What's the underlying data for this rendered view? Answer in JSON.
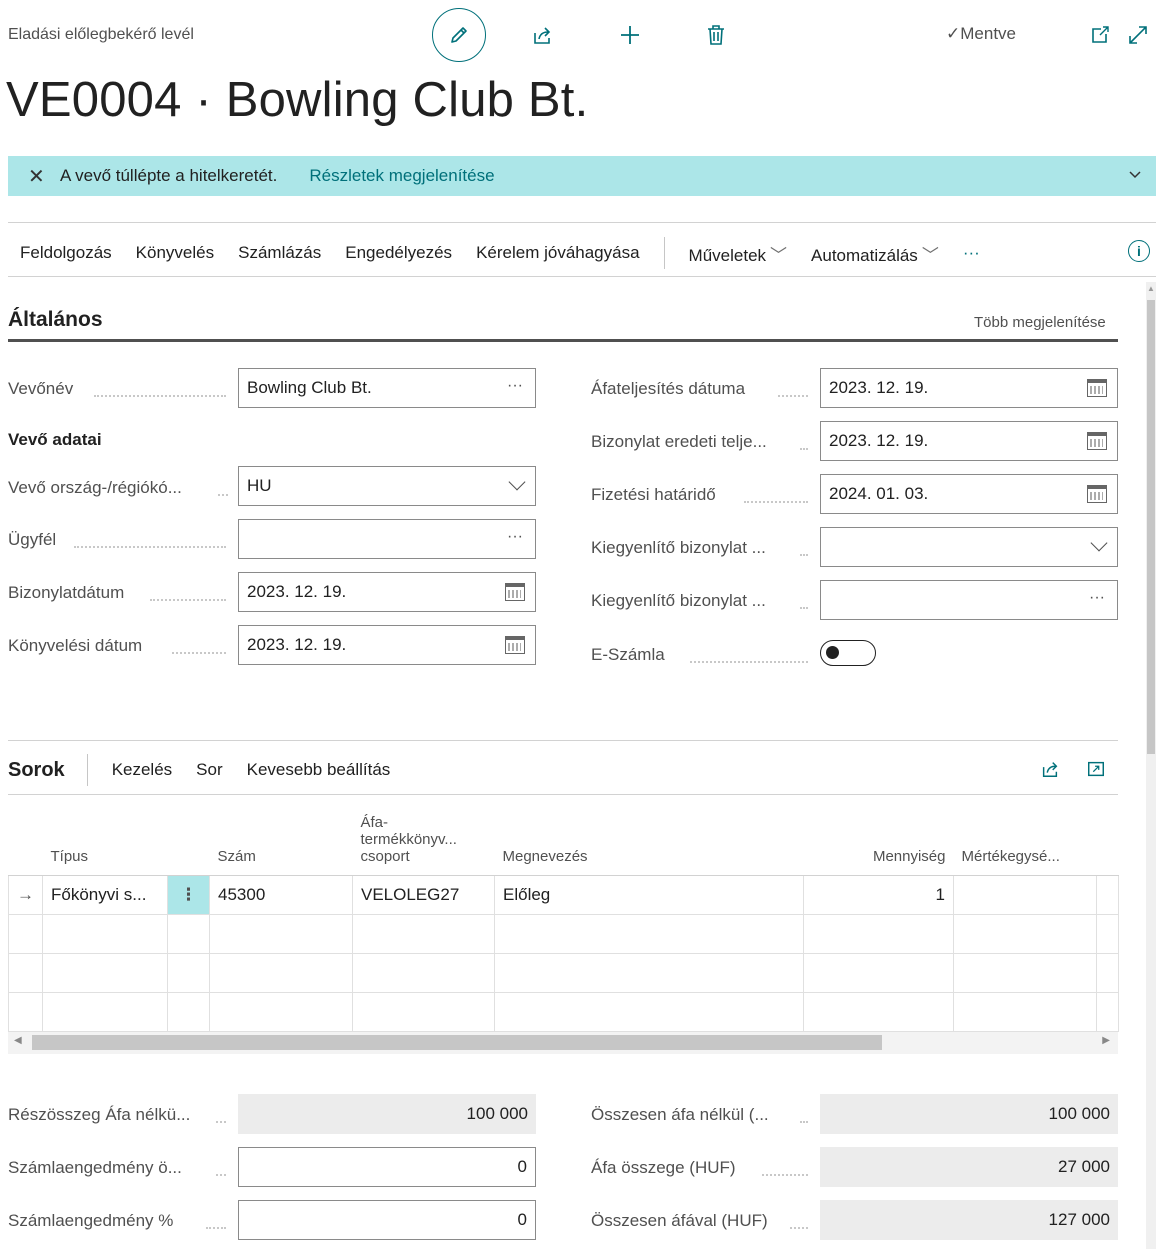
{
  "header": {
    "page_caption": "Eladási előlegbekérő levél",
    "saved_label": "Mentve",
    "title": "VE0004 · Bowling Club Bt."
  },
  "notification": {
    "message": "A vevő túllépte a hitelkeretét.",
    "link": "Részletek megjelenítése"
  },
  "actions": {
    "items": [
      "Feldolgozás",
      "Könyvelés",
      "Számlázás",
      "Engedélyezés",
      "Kérelem jóváhagyása"
    ],
    "menus": [
      "Műveletek",
      "Automatizálás"
    ],
    "more": "···",
    "info": "i"
  },
  "general": {
    "title": "Általános",
    "show_more": "Több megjelenítése",
    "customer_name_label": "Vevőnév",
    "customer_name_value": "Bowling Club Bt.",
    "customer_data_heading": "Vevő adatai",
    "country_label": "Vevő ország-/régiókó...",
    "country_value": "HU",
    "client_label": "Ügyfél",
    "client_value": "",
    "doc_date_label": "Bizonylatdátum",
    "doc_date_value": "2023. 12. 19.",
    "posting_date_label": "Könyvelési dátum",
    "posting_date_value": "2023. 12. 19.",
    "vat_date_label": "Áfateljesítés dátuma",
    "vat_date_value": "2023. 12. 19.",
    "orig_doc_label": "Bizonylat eredeti telje...",
    "orig_doc_value": "2023. 12. 19.",
    "due_date_label": "Fizetési határidő",
    "due_date_value": "2024. 01. 03.",
    "applies_type_label": "Kiegyenlítő bizonylat ...",
    "applies_type_value": "",
    "applies_no_label": "Kiegyenlítő bizonylat ...",
    "applies_no_value": "",
    "einvoice_label": "E-Számla",
    "suffix_dots": "···"
  },
  "lines": {
    "title": "Sorok",
    "actions": [
      "Kezelés",
      "Sor",
      "Kevesebb beállítás"
    ],
    "columns": {
      "type": "Típus",
      "number": "Szám",
      "vat_group_1": "Áfa-",
      "vat_group_2": "termékkönyv...",
      "vat_group_3": "csoport",
      "description": "Megnevezés",
      "quantity": "Mennyiség",
      "uom": "Mértékegysé..."
    },
    "rows": [
      {
        "marker": "→",
        "type": "Főkönyvi s...",
        "number": "45300",
        "vat_group": "VELOLEG27",
        "description": "Előleg",
        "quantity": "1",
        "uom": ""
      }
    ],
    "row_menu": "⋮"
  },
  "totals": {
    "subtotal_label": "Részösszeg Áfa nélkü...",
    "subtotal_value": "100 000",
    "inv_disc_amt_label": "Számlaengedmény ö...",
    "inv_disc_amt_value": "0",
    "inv_disc_pct_label": "Számlaengedmény %",
    "inv_disc_pct_value": "0",
    "total_excl_label": "Összesen áfa nélkül (...",
    "total_excl_value": "100 000",
    "vat_amount_label": "Áfa összege (HUF)",
    "vat_amount_value": "27 000",
    "total_incl_label": "Összesen áfával (HUF)",
    "total_incl_value": "127 000"
  }
}
